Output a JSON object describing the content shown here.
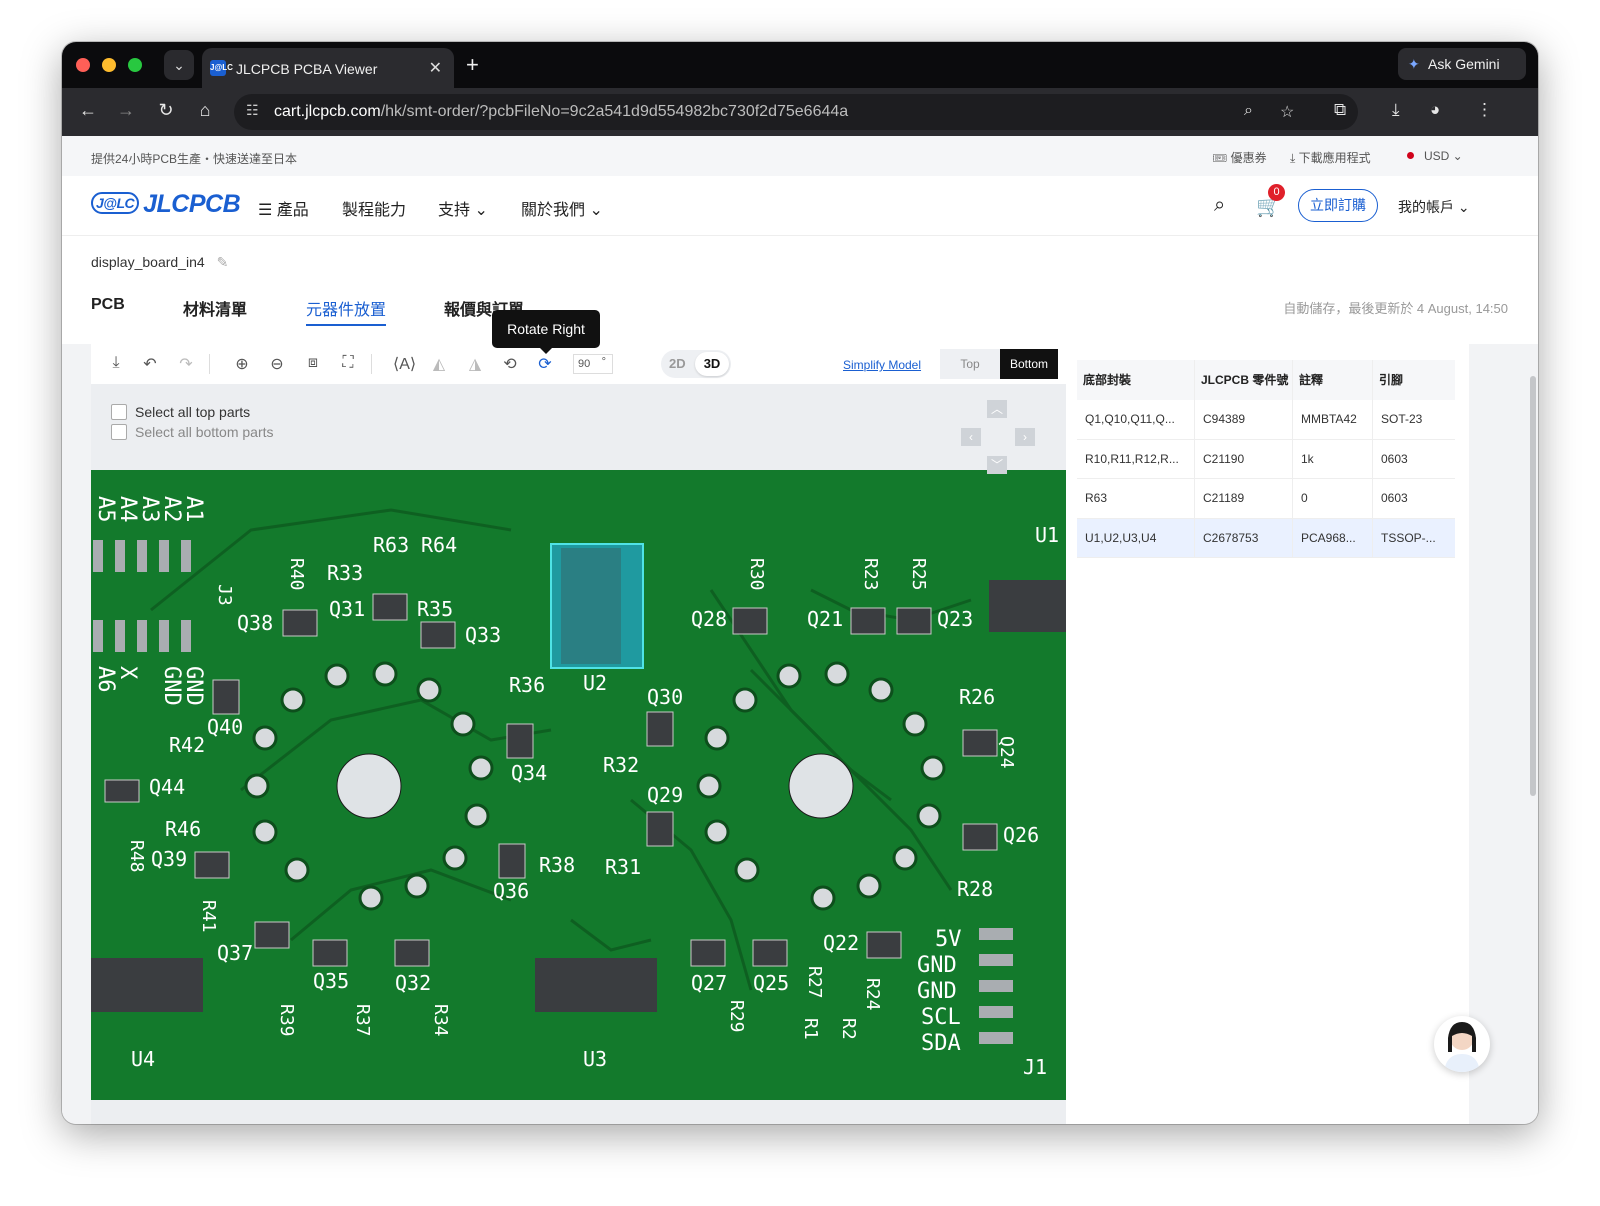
{
  "browser": {
    "tab_title": "JLCPCB PCBA Viewer",
    "tab_favicon_text": "J@LC",
    "gemini_label": "Ask Gemini",
    "url_host": "cart.jlcpcb.com",
    "url_path": "/hk/smt-order/?pcbFileNo=9c2a541d9d554982bc730f2d75e6644a"
  },
  "announcement": {
    "left": "提供24小時PCB生產・快速送達至日本",
    "coupon": "優惠券",
    "download_app": "下載應用程式",
    "currency": "USD"
  },
  "header": {
    "logo_mark": "J@LC",
    "logo_text": "JLCPCB",
    "menu": [
      "☰ 產品",
      "製程能力",
      "支持 ⌄",
      "關於我們 ⌄"
    ],
    "cart_count": "0",
    "order_now": "立即訂購",
    "account": "我的帳戶 ⌄"
  },
  "project": {
    "name": "display_board_in4",
    "tabs": [
      "PCB",
      "材料清單",
      "元器件放置",
      "報價與訂單"
    ],
    "active_tab": 2,
    "autosave": "自動儲存，最後更新於 4 August, 14:50"
  },
  "viewer": {
    "tooltip": "Rotate Right",
    "rotation_value": "90",
    "rotation_unit": "°",
    "mode_2d": "2D",
    "mode_3d": "3D",
    "simplify": "Simplify Model",
    "side_top": "Top",
    "side_bottom": "Bottom",
    "select_top": "Select all top parts",
    "select_bottom": "Select all bottom parts"
  },
  "bom": {
    "headers": [
      "底部封裝",
      "JLCPCB 零件號",
      "註釋",
      "引腳"
    ],
    "rows": [
      [
        "Q1,Q10,Q11,Q...",
        "C94389",
        "MMBTA42",
        "SOT-23"
      ],
      [
        "R10,R11,R12,R...",
        "C21190",
        "1k",
        "0603"
      ],
      [
        "R63",
        "C21189",
        "0",
        "0603"
      ],
      [
        "U1,U2,U3,U4",
        "C2678753",
        "PCA968...",
        "TSSOP-..."
      ]
    ]
  },
  "pcb_labels": {
    "header_pins": [
      "A1",
      "A2",
      "A3",
      "A4",
      "A5"
    ],
    "bottom_pins": [
      "GND",
      "GND",
      "X",
      "A6"
    ],
    "j1_pins": [
      "5V",
      "GND",
      "GND",
      "SCL",
      "SDA"
    ],
    "refs": [
      "R63",
      "R64",
      "R40",
      "R33",
      "Q31",
      "R35",
      "Q33",
      "Q38",
      "J3",
      "Q40",
      "R42",
      "Q44",
      "R46",
      "R48",
      "Q39",
      "R41",
      "Q37",
      "Q35",
      "R37",
      "Q32",
      "R34",
      "R39",
      "U4",
      "U2",
      "R36",
      "Q34",
      "Q30",
      "R32",
      "Q29",
      "Q36",
      "R38",
      "R31",
      "U3",
      "R30",
      "Q28",
      "R23",
      "Q21",
      "R25",
      "Q23",
      "U1",
      "R26",
      "Q24",
      "Q26",
      "R28",
      "Q22",
      "Q27",
      "R29",
      "Q25",
      "R27",
      "R24",
      "R1",
      "R2",
      "J1",
      "R2"
    ]
  },
  "colors": {
    "accent": "#1a5fd1",
    "pcb_green": "#137a2c",
    "silkscreen": "#ffffff"
  }
}
